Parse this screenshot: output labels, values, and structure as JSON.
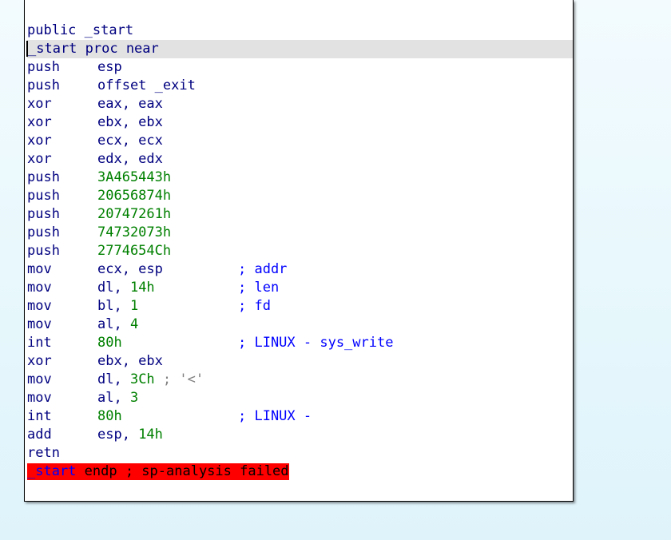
{
  "disassembly": {
    "header": "public _start",
    "proc_line": "_start proc near",
    "lines": [
      {
        "mn": "push",
        "op": "esp",
        "op_num": "",
        "op_tail": "",
        "comment": ""
      },
      {
        "mn": "push",
        "op": "offset _exit",
        "op_num": "",
        "op_tail": "",
        "comment": ""
      },
      {
        "mn": "xor",
        "op": "eax, eax",
        "op_num": "",
        "op_tail": "",
        "comment": ""
      },
      {
        "mn": "xor",
        "op": "ebx, ebx",
        "op_num": "",
        "op_tail": "",
        "comment": ""
      },
      {
        "mn": "xor",
        "op": "ecx, ecx",
        "op_num": "",
        "op_tail": "",
        "comment": ""
      },
      {
        "mn": "xor",
        "op": "edx, edx",
        "op_num": "",
        "op_tail": "",
        "comment": ""
      },
      {
        "mn": "push",
        "op": "",
        "op_num": "3A465443h",
        "op_tail": "",
        "comment": ""
      },
      {
        "mn": "push",
        "op": "",
        "op_num": "20656874h",
        "op_tail": "",
        "comment": ""
      },
      {
        "mn": "push",
        "op": "",
        "op_num": "20747261h",
        "op_tail": "",
        "comment": ""
      },
      {
        "mn": "push",
        "op": "",
        "op_num": "74732073h",
        "op_tail": "",
        "comment": ""
      },
      {
        "mn": "push",
        "op": "",
        "op_num": "2774654Ch",
        "op_tail": "",
        "comment": ""
      },
      {
        "mn": "mov",
        "op": "ecx, esp",
        "op_num": "",
        "op_tail": "",
        "comment": "; addr"
      },
      {
        "mn": "mov",
        "op": "dl, ",
        "op_num": "14h",
        "op_tail": "",
        "comment": "; len"
      },
      {
        "mn": "mov",
        "op": "bl, ",
        "op_num": "1",
        "op_tail": "",
        "comment": "; fd"
      },
      {
        "mn": "mov",
        "op": "al, ",
        "op_num": "4",
        "op_tail": "",
        "comment": ""
      },
      {
        "mn": "int",
        "op": "",
        "op_num": "80h",
        "op_tail": "",
        "comment": "; LINUX - sys_write"
      },
      {
        "mn": "xor",
        "op": "ebx, ebx",
        "op_num": "",
        "op_tail": "",
        "comment": ""
      },
      {
        "mn": "mov",
        "op": "dl, ",
        "op_num": "3Ch",
        "op_tail": " ; '<'",
        "comment": ""
      },
      {
        "mn": "mov",
        "op": "al, ",
        "op_num": "3",
        "op_tail": "",
        "comment": ""
      },
      {
        "mn": "int",
        "op": "",
        "op_num": "80h",
        "op_tail": "",
        "comment": "; LINUX -"
      },
      {
        "mn": "add",
        "op": "esp, ",
        "op_num": "14h",
        "op_tail": "",
        "comment": ""
      },
      {
        "mn": "retn",
        "op": "",
        "op_num": "",
        "op_tail": "",
        "comment": ""
      }
    ],
    "endp_label": "_start",
    "endp_text": " endp ; sp-analysis failed"
  },
  "colors": {
    "mnemonic": "#000080",
    "number": "#008000",
    "error_bg": "#ff0000",
    "highlight": "#e2e2e2"
  }
}
